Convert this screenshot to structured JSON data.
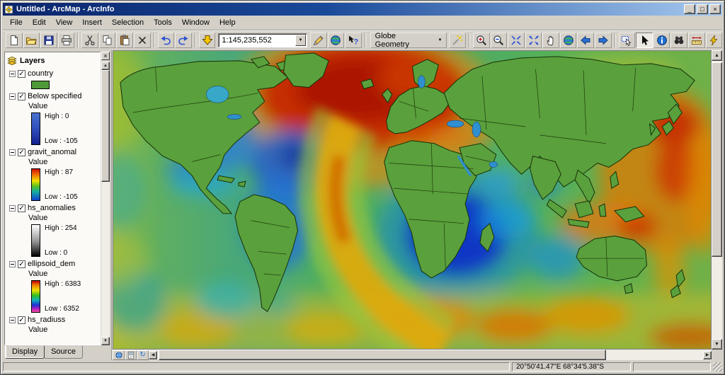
{
  "window": {
    "title": "Untitled - ArcMap - ArcInfo"
  },
  "icons": {
    "check": "✓",
    "close": "×",
    "minimize": "_",
    "maximize": "□",
    "up": "▲",
    "down": "▼",
    "left": "◀",
    "right": "▶",
    "dropdown": "▼",
    "refresh": "↻"
  },
  "menu": {
    "items": [
      "File",
      "Edit",
      "View",
      "Insert",
      "Selection",
      "Tools",
      "Window",
      "Help"
    ]
  },
  "toolbar": {
    "scale_value": "1:145,235,552",
    "globe_geometry_label": "Globe Geometry",
    "buttons": [
      "new-document",
      "open",
      "save",
      "print",
      "cut",
      "copy",
      "paste",
      "delete",
      "undo",
      "redo",
      "add-data",
      "map-scale-combo",
      "editor-pencil",
      "globe-view",
      "help",
      "globe-geometry-dropdown",
      "magic-wand",
      "zoom-in",
      "zoom-out",
      "fixed-zoom-in",
      "fixed-zoom-out",
      "pan",
      "full-extent",
      "go-back",
      "go-forward",
      "select-features",
      "select-elements",
      "identify",
      "find",
      "measure",
      "hyperlink"
    ]
  },
  "toc": {
    "root_label": "Layers",
    "tabs": [
      "Display",
      "Source"
    ],
    "layers": [
      {
        "name": "country"
      },
      {
        "name": "Below specified",
        "value_label": "Value",
        "high": "High : 0",
        "low": "Low : -105"
      },
      {
        "name": "gravit_anomal",
        "value_label": "Value",
        "high": "High : 87",
        "low": "Low : -105"
      },
      {
        "name": "hs_anomalies",
        "value_label": "Value",
        "high": "High : 254",
        "low": "Low : 0"
      },
      {
        "name": "ellipsoid_dem",
        "value_label": "Value",
        "high": "High : 6383",
        "low": "Low : 6352"
      },
      {
        "name": "hs_radiuss",
        "value_label": "Value"
      }
    ]
  },
  "statusbar": {
    "coordinates": "20°50'41.47\"E  68°34'5.38\"S"
  },
  "colors": {
    "chrome": "#d4d0c8",
    "titlebar_start": "#0a246a",
    "titlebar_end": "#a6caf0",
    "land_green": "#5aa03c",
    "anomaly_high_red": "#c62800",
    "anomaly_low_blue": "#1030c8"
  }
}
